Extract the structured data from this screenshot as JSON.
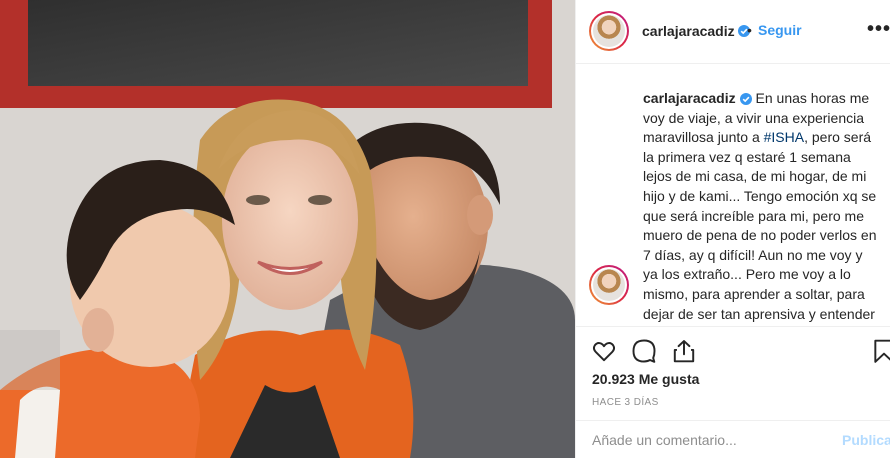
{
  "post": {
    "username": "carlajaracadiz",
    "verified_icon": "verified-badge-icon",
    "separator": "•",
    "follow_label": "Seguir",
    "more_label": "•••"
  },
  "caption": {
    "username": "carlajaracadiz",
    "text_before": "En unas horas me voy de viaje, a vivir una experiencia maravillosa junto a ",
    "hashtag": "#ISHA",
    "text_after": ", pero será la primera vez q estaré 1 semana lejos de mi casa, de mi hogar, de mi hijo y de kami... Tengo emoción xq se que será increíble para mi, pero me muero de pena de no poder verlos en 7 días, ay q difícil! Aun no me voy y ya los extraño... Pero me voy a lo mismo, para aprender a soltar, para dejar de ser tan aprensiva y entender que puedo salir y no sentirme culpable"
  },
  "actions": {
    "icons": [
      "heart-icon",
      "comment-icon",
      "share-icon",
      "bookmark-icon"
    ]
  },
  "likes_text": "20.923 Me gusta",
  "time_text": "HACE 3 DÍAS",
  "comment": {
    "placeholder": "Añade un comentario...",
    "publish_label": "Publicar"
  },
  "colors": {
    "link_blue": "#3897f0",
    "publish_disabled": "#b3dbff",
    "hashtag": "#00376b",
    "border": "#efefef"
  }
}
